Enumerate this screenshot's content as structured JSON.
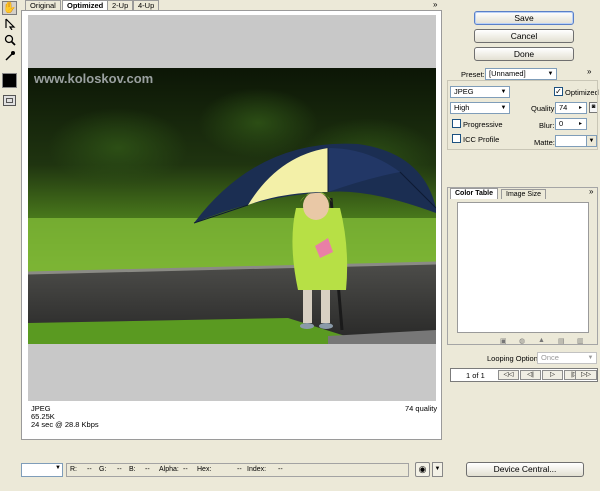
{
  "tabs": [
    "Original",
    "Optimized",
    "2-Up",
    "4-Up"
  ],
  "selected_tab": "Optimized",
  "watermark": "www.koloskov.com",
  "image_info": {
    "format": "JPEG",
    "size": "65.25K",
    "time": "24 sec @ 28.8 Kbps",
    "quality_label": "74 quality"
  },
  "buttons": {
    "save": "Save",
    "cancel": "Cancel",
    "done": "Done",
    "device_central": "Device Central..."
  },
  "settings": {
    "preset_label": "Preset:",
    "preset_value": "[Unnamed]",
    "format": "JPEG",
    "optimized_label": "Optimized",
    "optimized_checked": true,
    "quality_level": "High",
    "quality_label": "Quality:",
    "quality_value": "74",
    "progressive_label": "Progressive",
    "blur_label": "Blur:",
    "blur_value": "0",
    "icc_label": "ICC Profile",
    "matte_label": "Matte:"
  },
  "panel_tabs": [
    "Color Table",
    "Image Size"
  ],
  "looping_label": "Looping Options:",
  "looping_value": "Once",
  "frame_counter": "1 of 1",
  "status_bar": {
    "r_label": "R:",
    "r_value": "--",
    "g_label": "G:",
    "g_value": "--",
    "b_label": "B:",
    "b_value": "--",
    "alpha_label": "Alpha:",
    "alpha_value": "--",
    "hex_label": "Hex:",
    "hex_value": "--",
    "index_label": "Index:",
    "index_value": "--"
  },
  "icons": {
    "tools": [
      "hand-icon",
      "slice-select-icon",
      "zoom-icon",
      "eyedropper-icon",
      "color-swatch",
      "toggle-slices-icon"
    ],
    "colortable": [
      "map-transparent-icon",
      "web-snap-icon",
      "lock-color-icon",
      "new-color-icon",
      "trash-icon"
    ],
    "playback": [
      "first-frame-icon",
      "prev-frame-icon",
      "play-icon",
      "next-frame-icon",
      "last-frame-icon"
    ]
  },
  "colors": {
    "chrome": "#ece9d8",
    "default_button_border": "#5a7fc7",
    "preview_gray": "#c8c8c8"
  }
}
